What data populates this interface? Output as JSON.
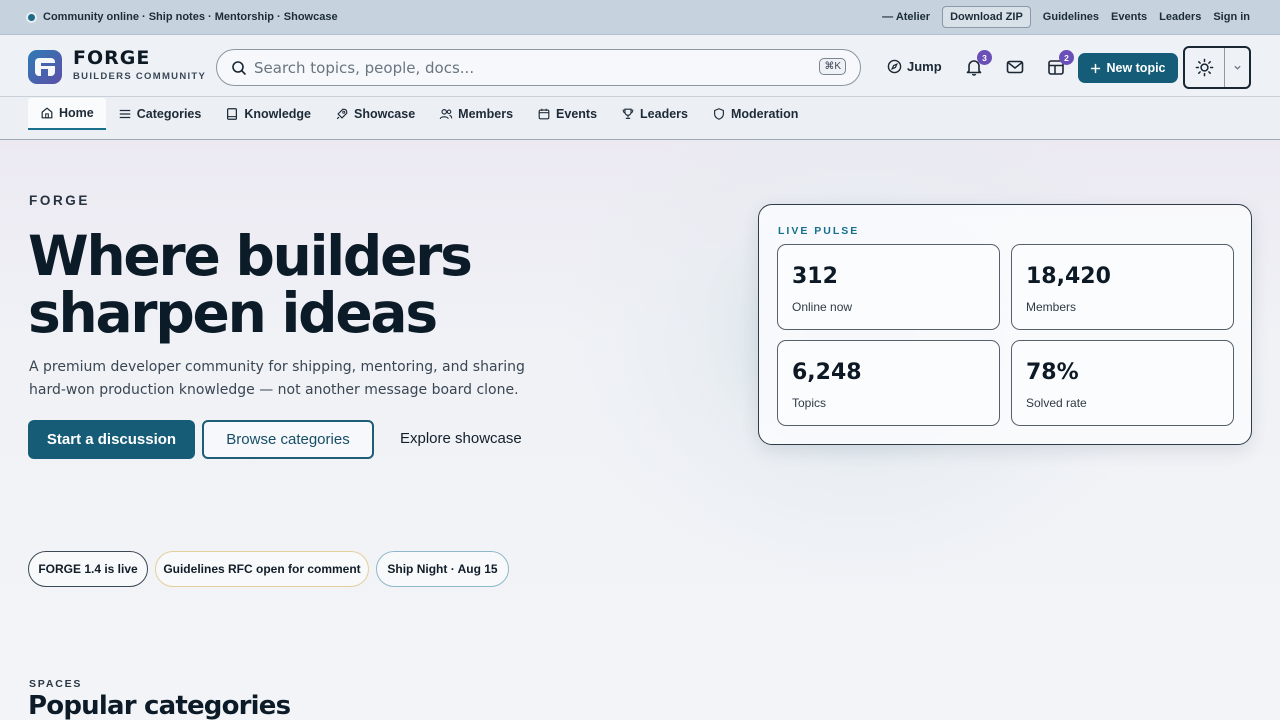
{
  "topstrip": {
    "status": "Community online · Ship notes · Mentorship · Showcase",
    "atelier": "— Atelier",
    "download": "Download ZIP",
    "links": [
      "Guidelines",
      "Events",
      "Leaders",
      "Sign in"
    ]
  },
  "header": {
    "brand_name": "FORGE",
    "brand_sub": "BUILDERS COMMUNITY",
    "search_placeholder": "Search topics, people, docs...",
    "search_shortcut": "⌘K",
    "jump_label": "Jump",
    "notifications_badge": "3",
    "inbox_badge": "2",
    "new_topic_label": "New topic",
    "icons": [
      "search-icon",
      "compass-icon",
      "bell-icon",
      "mail-icon",
      "layout-icon",
      "plus-icon",
      "sun-icon",
      "chevron-down-icon"
    ]
  },
  "nav": {
    "items": [
      {
        "label": "Home",
        "icon": "home-icon"
      },
      {
        "label": "Categories",
        "icon": "list-icon"
      },
      {
        "label": "Knowledge",
        "icon": "book-icon"
      },
      {
        "label": "Showcase",
        "icon": "rocket-icon"
      },
      {
        "label": "Members",
        "icon": "users-icon"
      },
      {
        "label": "Events",
        "icon": "calendar-icon"
      },
      {
        "label": "Leaders",
        "icon": "trophy-icon"
      },
      {
        "label": "Moderation",
        "icon": "shield-icon"
      }
    ],
    "active": "Home"
  },
  "hero": {
    "eyebrow": "FORGE",
    "headline_line1": "Where builders",
    "headline_line2": "sharpen ideas",
    "lead": "A premium developer community for shipping, mentoring, and sharing hard-won production knowledge — not another message board clone.",
    "primary_cta": "Start a discussion",
    "secondary_cta": "Browse categories",
    "tertiary_cta": "Explore showcase"
  },
  "pulse": {
    "title": "LIVE PULSE",
    "stats": [
      {
        "value": "312",
        "label": "Online now"
      },
      {
        "value": "18,420",
        "label": "Members"
      },
      {
        "value": "6,248",
        "label": "Topics"
      },
      {
        "value": "78%",
        "label": "Solved rate"
      }
    ]
  },
  "announcements": [
    "FORGE 1.4 is live",
    "Guidelines RFC open for comment",
    "Ship Night · Aug 15"
  ],
  "spaces": {
    "eyebrow": "SPACES",
    "title": "Popular categories"
  },
  "colors": {
    "accent": "#165c77",
    "badge": "#6a4fb8",
    "pulse_title": "#16708d"
  }
}
